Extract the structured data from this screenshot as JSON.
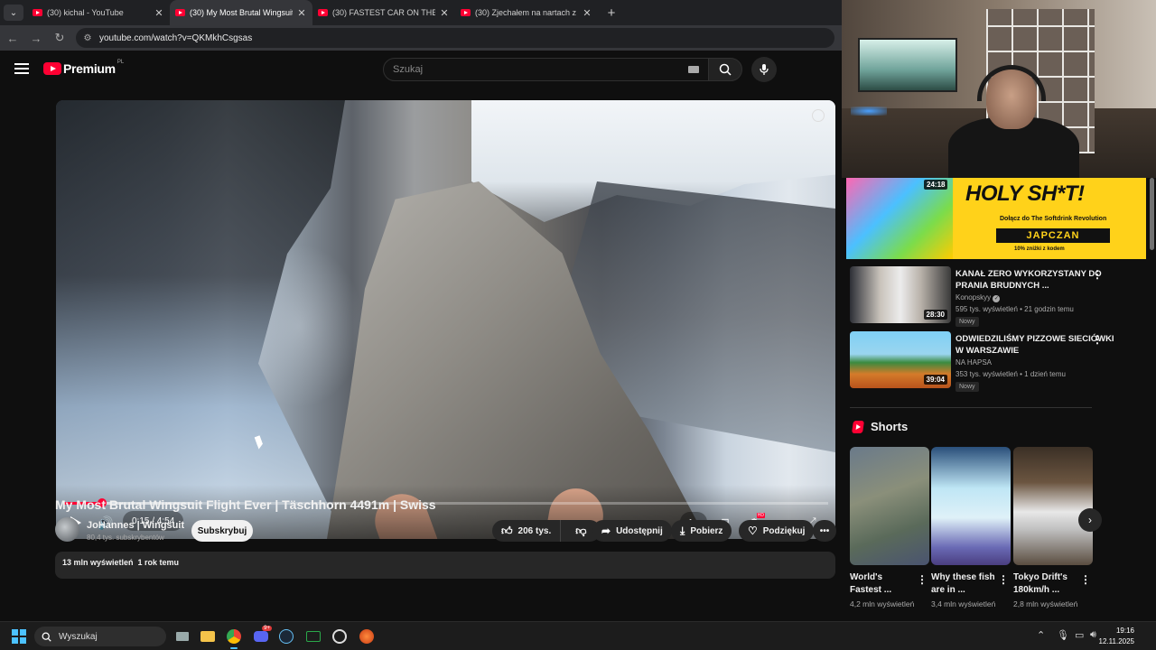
{
  "browser": {
    "tabs": [
      {
        "title": "(30) kichal - YouTube",
        "active": false
      },
      {
        "title": "(30) My Most Brutal Wingsuit F",
        "active": true
      },
      {
        "title": "(30) FASTEST CAR ON THE PLA",
        "active": false
      },
      {
        "title": "(30) Zjechałem na nartach z Mo",
        "active": false
      }
    ],
    "url": "youtube.com/watch?v=QKMkhCsgsas"
  },
  "youtube": {
    "logo_text": "Premium",
    "logo_region": "PL",
    "search_placeholder": "Szukaj",
    "player": {
      "time": "0:15 / 4:54",
      "played_fraction": 0.051,
      "buffered_fraction": 0.17,
      "accent_color": "#ff0033"
    },
    "video": {
      "title": "My Most Brutal Wingsuit Flight Ever | Täschhorn 4491m | Swiss",
      "channel": "JoHannes | Wingsuit",
      "subscribers": "80,4 tys. subskrybentów",
      "subscribe_label": "Subskrybuj",
      "likes": "206 tys.",
      "share_label": "Udostępnij",
      "download_label": "Pobierz",
      "thanks_label": "Podziękuj",
      "description_meta": "13 mln wyświetleń  1 rok temu"
    },
    "sidebar": {
      "ad": {
        "duration": "24:18",
        "headline": "HOLY SH*T!",
        "subline": "Dołącz do The Softdrink Revolution",
        "brand": "JAPCZAN",
        "promo": "10% zniżki z kodem"
      },
      "recommendations": [
        {
          "title": "KANAŁ ZERO WYKORZYSTANY DO PRANIA BRUDNYCH ...",
          "channel": "Konopskyy",
          "verified": true,
          "meta": "595 tys. wyświetleń • 21 godzin temu",
          "badge": "Nowy",
          "duration": "28:30"
        },
        {
          "title": "ODWIEDZILIŚMY PIZZOWE SIECIÓWKI W WARSZAWIE",
          "channel": "NA HAPSA",
          "verified": false,
          "meta": "353 tys. wyświetleń • 1 dzień temu",
          "badge": "Nowy",
          "duration": "39:04"
        }
      ],
      "shorts_label": "Shorts",
      "shorts": [
        {
          "title": "World's Fastest ...",
          "views": "4,2 mln wyświetleń"
        },
        {
          "title": "Why these fish are in ...",
          "views": "3,4 mln wyświetleń"
        },
        {
          "title": "Tokyo Drift's 180km/h ...",
          "views": "2,8 mln wyświetleń"
        }
      ]
    }
  },
  "taskbar": {
    "search_label": "Wyszukaj",
    "time": "19:16",
    "date": "12.11.2025",
    "discord_badge": "9+"
  }
}
